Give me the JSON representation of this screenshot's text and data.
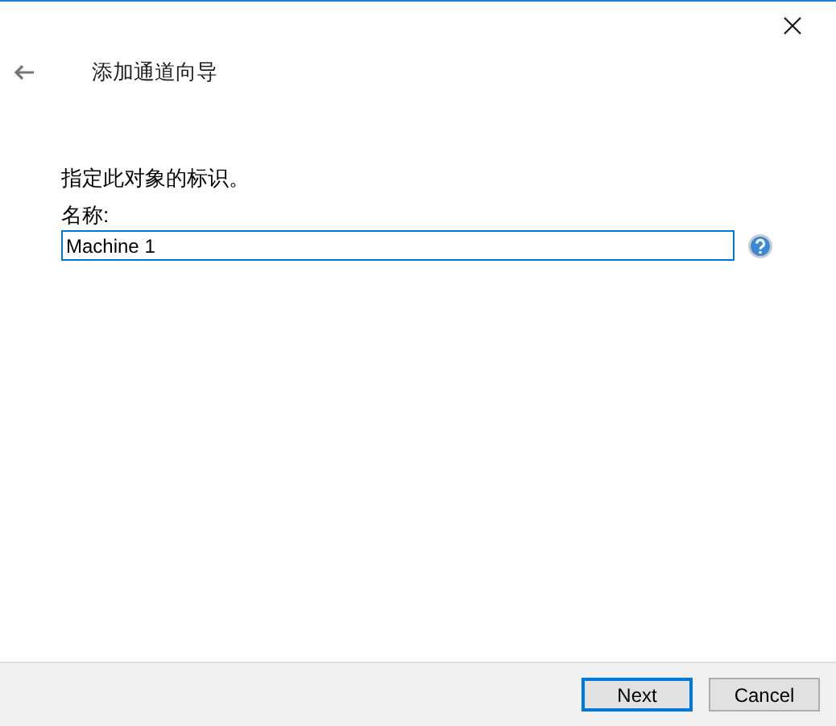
{
  "window": {
    "title": "添加通道向导"
  },
  "instruction": "指定此对象的标识。",
  "name_field": {
    "label": "名称:",
    "value": "Machine 1",
    "focused": true
  },
  "buttons": [
    {
      "label": "Next",
      "default": true
    },
    {
      "label": "Cancel",
      "default": false
    }
  ]
}
